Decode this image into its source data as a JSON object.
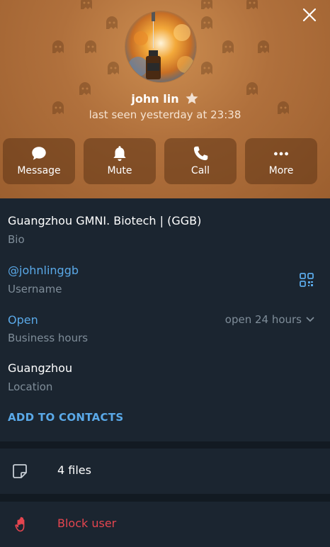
{
  "profile": {
    "name": "john lin",
    "status": "last seen yesterday at 23:38"
  },
  "actions": [
    {
      "label": "Message",
      "icon": "message-icon"
    },
    {
      "label": "Mute",
      "icon": "bell-icon"
    },
    {
      "label": "Call",
      "icon": "phone-icon"
    },
    {
      "label": "More",
      "icon": "more-icon"
    }
  ],
  "info": {
    "bio": {
      "value": "Guangzhou GMNI. Biotech | (GGB)",
      "label": "Bio"
    },
    "username": {
      "value": "@johnlinggb",
      "label": "Username"
    },
    "business_hours": {
      "value": "Open",
      "label": "Business hours",
      "toggle": "open 24 hours"
    },
    "location": {
      "value": "Guangzhou",
      "label": "Location"
    },
    "add_contacts": "ADD TO CONTACTS"
  },
  "files": {
    "label": "4 files",
    "icon": "file-icon"
  },
  "block": {
    "label": "Block user",
    "icon": "hand-stop-icon"
  },
  "colors": {
    "header": "#b0703c",
    "panel": "#1b2530",
    "accent_blue": "#5aa9e8",
    "danger": "#e5454f",
    "muted": "#7f8d99"
  }
}
